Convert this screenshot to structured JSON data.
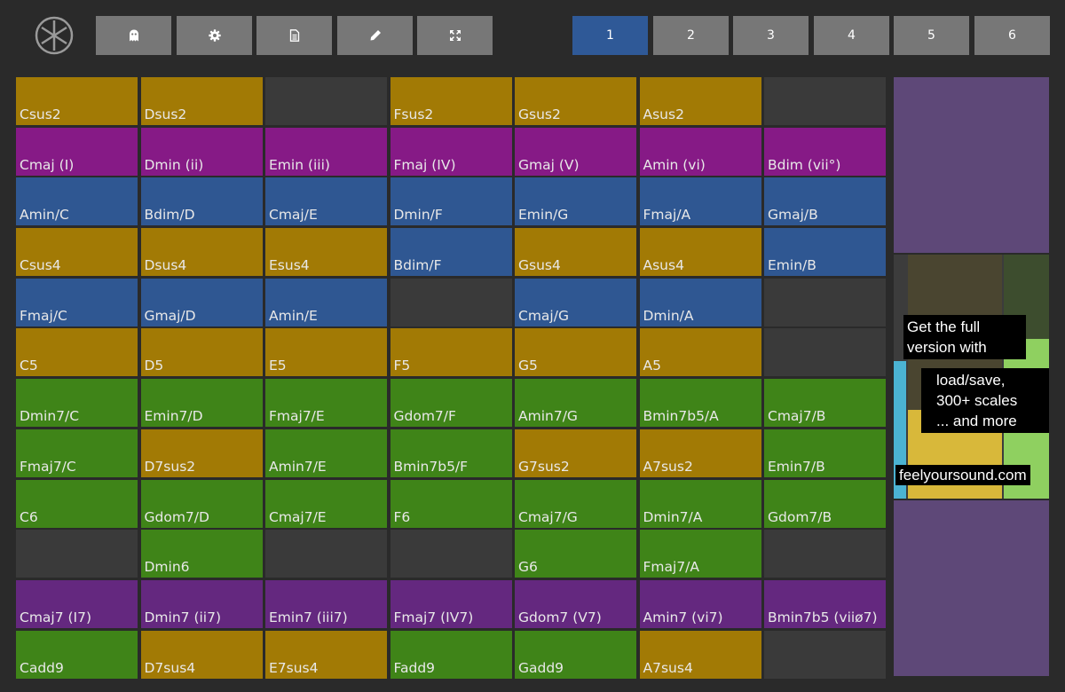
{
  "colors": {
    "sus": "#a27a05",
    "triad": "#861a86",
    "inversion": "#2f5792",
    "seventh": "#3f8418",
    "purple": "#64287f",
    "empty": "#3a3a3a",
    "active_page": "#2f5997",
    "button": "#777777"
  },
  "toolbar": {
    "buttons": [
      {
        "name": "ghost-button",
        "icon": "ghost-icon"
      },
      {
        "name": "settings-button",
        "icon": "gear-icon"
      },
      {
        "name": "document-button",
        "icon": "document-icon"
      },
      {
        "name": "edit-button",
        "icon": "pencil-icon"
      },
      {
        "name": "fullscreen-button",
        "icon": "expand-icon"
      }
    ],
    "pages": [
      "1",
      "2",
      "3",
      "4",
      "5",
      "6"
    ],
    "active_page": "1"
  },
  "grid": {
    "rows": [
      [
        {
          "label": "Csus2",
          "color": "sus"
        },
        {
          "label": "Dsus2",
          "color": "sus"
        },
        {
          "label": "",
          "color": "empty"
        },
        {
          "label": "Fsus2",
          "color": "sus"
        },
        {
          "label": "Gsus2",
          "color": "sus"
        },
        {
          "label": "Asus2",
          "color": "sus"
        },
        {
          "label": "",
          "color": "empty"
        }
      ],
      [
        {
          "label": "Cmaj (I)",
          "color": "triad"
        },
        {
          "label": "Dmin (ii)",
          "color": "triad"
        },
        {
          "label": "Emin (iii)",
          "color": "triad"
        },
        {
          "label": "Fmaj (IV)",
          "color": "triad"
        },
        {
          "label": "Gmaj (V)",
          "color": "triad"
        },
        {
          "label": "Amin (vi)",
          "color": "triad"
        },
        {
          "label": "Bdim (vii°)",
          "color": "triad"
        }
      ],
      [
        {
          "label": "Amin/C",
          "color": "inversion"
        },
        {
          "label": "Bdim/D",
          "color": "inversion"
        },
        {
          "label": "Cmaj/E",
          "color": "inversion"
        },
        {
          "label": "Dmin/F",
          "color": "inversion"
        },
        {
          "label": "Emin/G",
          "color": "inversion"
        },
        {
          "label": "Fmaj/A",
          "color": "inversion"
        },
        {
          "label": "Gmaj/B",
          "color": "inversion"
        }
      ],
      [
        {
          "label": "Csus4",
          "color": "sus"
        },
        {
          "label": "Dsus4",
          "color": "sus"
        },
        {
          "label": "Esus4",
          "color": "sus"
        },
        {
          "label": "Bdim/F",
          "color": "inversion"
        },
        {
          "label": "Gsus4",
          "color": "sus"
        },
        {
          "label": "Asus4",
          "color": "sus"
        },
        {
          "label": "Emin/B",
          "color": "inversion"
        }
      ],
      [
        {
          "label": "Fmaj/C",
          "color": "inversion"
        },
        {
          "label": "Gmaj/D",
          "color": "inversion"
        },
        {
          "label": "Amin/E",
          "color": "inversion"
        },
        {
          "label": "",
          "color": "empty"
        },
        {
          "label": "Cmaj/G",
          "color": "inversion"
        },
        {
          "label": "Dmin/A",
          "color": "inversion"
        },
        {
          "label": "",
          "color": "empty"
        }
      ],
      [
        {
          "label": "C5",
          "color": "sus"
        },
        {
          "label": "D5",
          "color": "sus"
        },
        {
          "label": "E5",
          "color": "sus"
        },
        {
          "label": "F5",
          "color": "sus"
        },
        {
          "label": "G5",
          "color": "sus"
        },
        {
          "label": "A5",
          "color": "sus"
        },
        {
          "label": "",
          "color": "empty"
        }
      ],
      [
        {
          "label": "Dmin7/C",
          "color": "seventh"
        },
        {
          "label": "Emin7/D",
          "color": "seventh"
        },
        {
          "label": "Fmaj7/E",
          "color": "seventh"
        },
        {
          "label": "Gdom7/F",
          "color": "seventh"
        },
        {
          "label": "Amin7/G",
          "color": "seventh"
        },
        {
          "label": "Bmin7b5/A",
          "color": "seventh"
        },
        {
          "label": "Cmaj7/B",
          "color": "seventh"
        }
      ],
      [
        {
          "label": "Fmaj7/C",
          "color": "seventh"
        },
        {
          "label": "D7sus2",
          "color": "sus"
        },
        {
          "label": "Amin7/E",
          "color": "seventh"
        },
        {
          "label": "Bmin7b5/F",
          "color": "seventh"
        },
        {
          "label": "G7sus2",
          "color": "sus"
        },
        {
          "label": "A7sus2",
          "color": "sus"
        },
        {
          "label": "Emin7/B",
          "color": "seventh"
        }
      ],
      [
        {
          "label": "C6",
          "color": "seventh"
        },
        {
          "label": "Gdom7/D",
          "color": "seventh"
        },
        {
          "label": "Cmaj7/E",
          "color": "seventh"
        },
        {
          "label": "F6",
          "color": "seventh"
        },
        {
          "label": "Cmaj7/G",
          "color": "seventh"
        },
        {
          "label": "Dmin7/A",
          "color": "seventh"
        },
        {
          "label": "Gdom7/B",
          "color": "seventh"
        }
      ],
      [
        {
          "label": "",
          "color": "empty"
        },
        {
          "label": "Dmin6",
          "color": "seventh"
        },
        {
          "label": "",
          "color": "empty"
        },
        {
          "label": "",
          "color": "empty"
        },
        {
          "label": "G6",
          "color": "seventh"
        },
        {
          "label": "Fmaj7/A",
          "color": "seventh"
        },
        {
          "label": "",
          "color": "empty"
        }
      ],
      [
        {
          "label": "Cmaj7 (I7)",
          "color": "purple"
        },
        {
          "label": "Dmin7 (ii7)",
          "color": "purple"
        },
        {
          "label": "Emin7 (iii7)",
          "color": "purple"
        },
        {
          "label": "Fmaj7 (IV7)",
          "color": "purple"
        },
        {
          "label": "Gdom7 (V7)",
          "color": "purple"
        },
        {
          "label": "Amin7 (vi7)",
          "color": "purple"
        },
        {
          "label": "Bmin7b5 (viiø7)",
          "color": "purple"
        }
      ],
      [
        {
          "label": "Cadd9",
          "color": "seventh"
        },
        {
          "label": "D7sus4",
          "color": "sus"
        },
        {
          "label": "E7sus4",
          "color": "sus"
        },
        {
          "label": "Fadd9",
          "color": "seventh"
        },
        {
          "label": "Gadd9",
          "color": "seventh"
        },
        {
          "label": "A7sus4",
          "color": "sus"
        },
        {
          "label": "",
          "color": "empty"
        }
      ]
    ]
  },
  "ad": {
    "line1": "Get the full",
    "line2": "version with",
    "line3": "load/save,",
    "line4": "300+ scales",
    "line5": "... and more",
    "url": "feelyoursound.com"
  }
}
